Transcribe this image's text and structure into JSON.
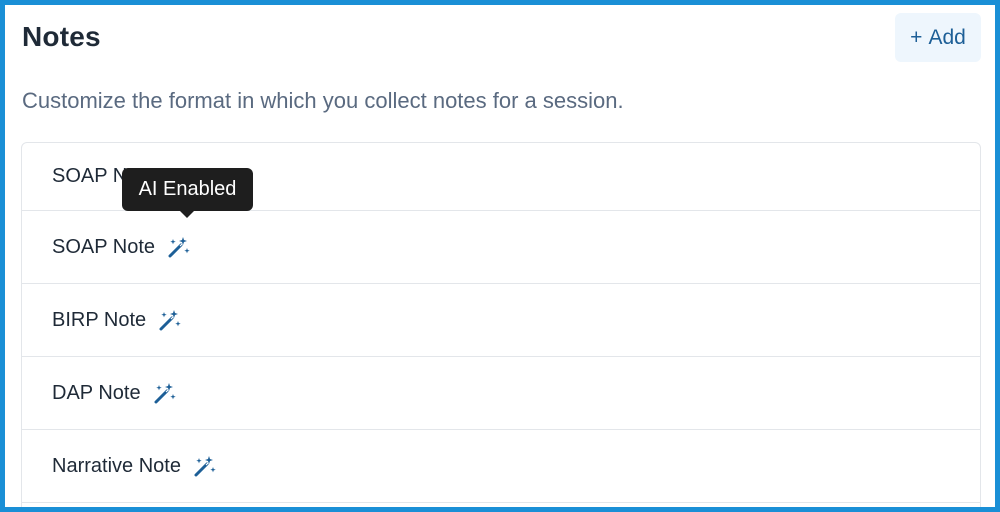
{
  "header": {
    "title": "Notes",
    "add_button_label": "Add",
    "add_button_icon": "plus-icon",
    "subtitle": "Customize the format in which you collect notes for a session."
  },
  "notes": [
    {
      "label": "SOAP Note",
      "ai_enabled": false
    },
    {
      "label": "SOAP Note",
      "ai_enabled": true
    },
    {
      "label": "BIRP Note",
      "ai_enabled": true
    },
    {
      "label": "DAP Note",
      "ai_enabled": true
    },
    {
      "label": "Narrative Note",
      "ai_enabled": true
    }
  ],
  "tooltip": {
    "text": "AI Enabled"
  },
  "icons": {
    "ai": "magic-wand-sparkles-icon"
  },
  "colors": {
    "frame_border": "#1a8fd6",
    "accent": "#1d5f97",
    "add_button_bg": "#eef6fd",
    "tooltip_bg": "#1e1e1e",
    "ai_icon": "#1d5f97"
  }
}
